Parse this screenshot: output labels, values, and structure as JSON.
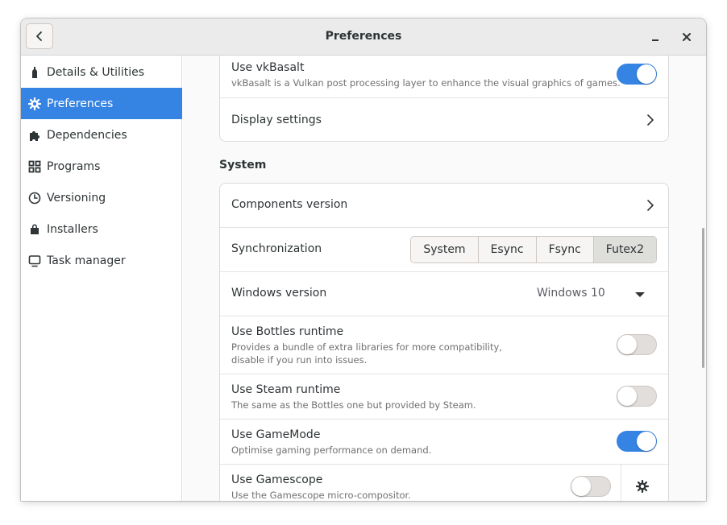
{
  "window": {
    "title": "Preferences"
  },
  "sidebar": {
    "items": [
      {
        "label": "Details & Utilities",
        "icon": "bottle-icon",
        "active": false
      },
      {
        "label": "Preferences",
        "icon": "gear-icon",
        "active": true
      },
      {
        "label": "Dependencies",
        "icon": "puzzle-icon",
        "active": false
      },
      {
        "label": "Programs",
        "icon": "grid-icon",
        "active": false
      },
      {
        "label": "Versioning",
        "icon": "clock-icon",
        "active": false
      },
      {
        "label": "Installers",
        "icon": "bag-icon",
        "active": false
      },
      {
        "label": "Task manager",
        "icon": "monitor-icon",
        "active": false
      }
    ]
  },
  "graphics": {
    "vkbasalt": {
      "title": "Use vkBasalt",
      "subtitle": "vkBasalt is a Vulkan post processing layer to enhance the visual graphics of games.",
      "enabled": true
    },
    "display": {
      "title": "Display settings"
    }
  },
  "system": {
    "section_title": "System",
    "components": {
      "title": "Components version"
    },
    "sync": {
      "title": "Synchronization",
      "options": [
        "System",
        "Esync",
        "Fsync",
        "Futex2"
      ],
      "selected": "Futex2"
    },
    "windows_version": {
      "title": "Windows version",
      "value": "Windows 10"
    },
    "bottles_runtime": {
      "title": "Use Bottles runtime",
      "subtitle_1": "Provides a bundle of extra libraries for more compatibility,",
      "subtitle_2": "disable if you run into issues.",
      "enabled": false
    },
    "steam_runtime": {
      "title": "Use Steam runtime",
      "subtitle": "The same as the Bottles one but provided by Steam.",
      "enabled": false
    },
    "gamemode": {
      "title": "Use GameMode",
      "subtitle": "Optimise gaming performance on demand.",
      "enabled": true
    },
    "gamescope": {
      "title": "Use Gamescope",
      "subtitle": "Use the Gamescope micro-compositor.",
      "enabled": false
    }
  },
  "colors": {
    "accent": "#3584e4"
  }
}
